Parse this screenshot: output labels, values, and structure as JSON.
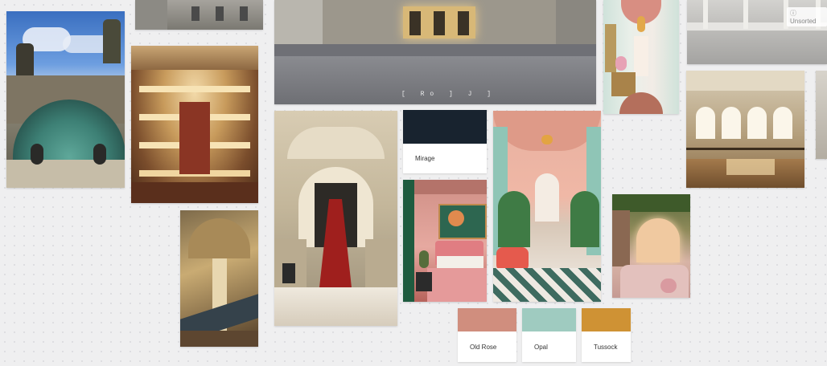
{
  "board": {
    "unsorted_label": "Unsorted",
    "unsorted_icon": "info-circle-icon",
    "image_toolbar_text": "[  Ro  ]  J  ]"
  },
  "swatches": [
    {
      "name": "Mirage",
      "color": "#18232f"
    },
    {
      "name": "Old Rose",
      "color": "#d08e7e"
    },
    {
      "name": "Opal",
      "color": "#9fcbc0"
    },
    {
      "name": "Tussock",
      "color": "#cf9234"
    }
  ],
  "images": [
    {
      "id": "opera-dome-statues",
      "subject": "green copper dome with statues, blue sky"
    },
    {
      "id": "ornate-theater-interior",
      "subject": "baroque theatre boxes in gold"
    },
    {
      "id": "grand-staircase",
      "subject": "ornate opera staircase"
    },
    {
      "id": "building-top-strip",
      "subject": "classical building facade"
    },
    {
      "id": "opera-facade-dusk",
      "subject": "opera house facade at dusk with plaza"
    },
    {
      "id": "red-carpet-staircase",
      "subject": "marble stairs with red carpet"
    },
    {
      "id": "pink-bedroom",
      "subject": "pink and green bedroom with bird painting"
    },
    {
      "id": "pink-mint-arcade",
      "subject": "coral and mint colonnade with checkered floor"
    },
    {
      "id": "mint-hallway",
      "subject": "mint hallway with coral ceiling and chandelier"
    },
    {
      "id": "empty-hall-top",
      "subject": "empty white ballroom"
    },
    {
      "id": "ballet-studio",
      "subject": "ballet studio with arched windows"
    },
    {
      "id": "pink-reading-nook",
      "subject": "cozy pink nook with greenery"
    },
    {
      "id": "edge-room",
      "subject": "partially visible room"
    }
  ]
}
